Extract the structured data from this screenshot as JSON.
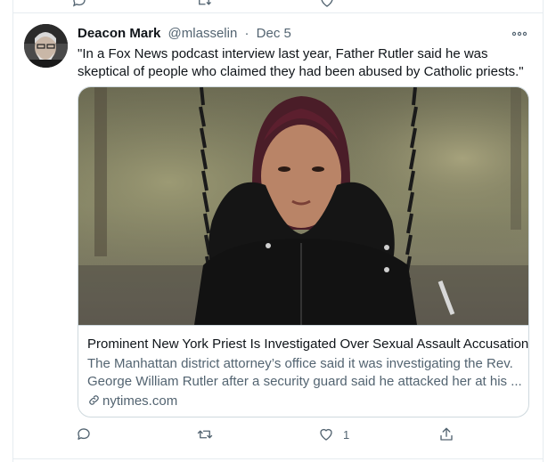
{
  "tweet": {
    "author_name": "Deacon Mark",
    "handle": "@mlasselin",
    "separator": "·",
    "date": "Dec 5",
    "text": "\"In a Fox News podcast interview last year, Father Rutler said he was skeptical of people who claimed they had been abused by Catholic priests.\"",
    "like_count": "1"
  },
  "card": {
    "title": "Prominent New York Priest Is Investigated Over Sexual Assault Accusation",
    "description_line1": "The Manhattan district attorney’s office said it was investigating the Rev.",
    "description_line2": "George William Rutler after a security guard said he attacked her at his ...",
    "domain": "nytimes.com"
  },
  "icons": {
    "more": "more-horizontal-icon",
    "reply": "reply-icon",
    "retweet": "retweet-icon",
    "like": "heart-icon",
    "share": "share-icon",
    "link": "link-icon"
  },
  "colors": {
    "text_primary": "#0f1419",
    "text_secondary": "#536471",
    "border": "#cfd9de",
    "divider": "#e6ecf0"
  }
}
